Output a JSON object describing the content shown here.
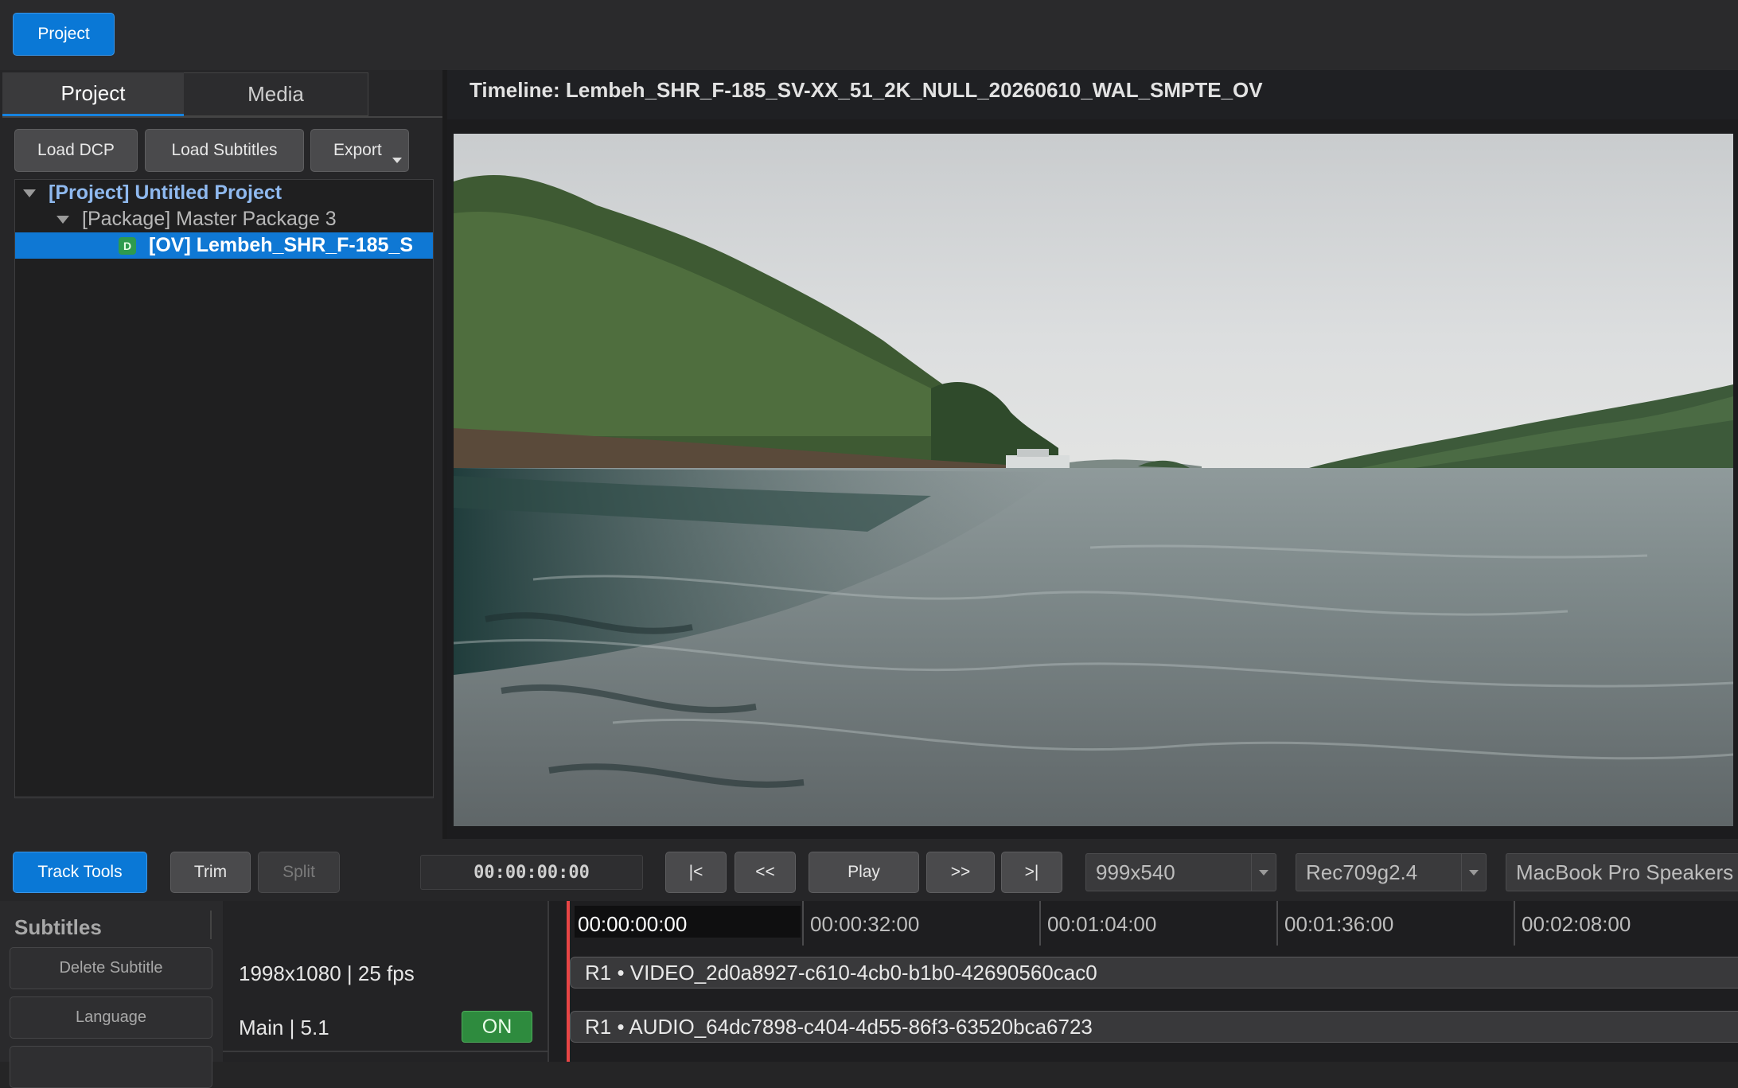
{
  "toolbar": {
    "project_button": "Project"
  },
  "left_panel": {
    "tabs": [
      {
        "label": "Project",
        "active": true
      },
      {
        "label": "Media",
        "active": false
      }
    ],
    "buttons": {
      "load_dcp": "Load DCP",
      "load_subtitles": "Load Subtitles",
      "export": "Export"
    },
    "tree": [
      {
        "label": "[Project] Untitled Project",
        "level": 0
      },
      {
        "label": "[Package] Master Package 3",
        "level": 1
      },
      {
        "label": "[OV] Lembeh_SHR_F-185_S",
        "level": 2,
        "badge": "D",
        "selected": true
      }
    ]
  },
  "viewer": {
    "title": "Timeline: Lembeh_SHR_F-185_SV-XX_51_2K_NULL_20260610_WAL_SMPTE_OV"
  },
  "transport": {
    "track_tools": "Track Tools",
    "trim": "Trim",
    "split": "Split",
    "timecode": "00:00:00:00",
    "go_start": "|<",
    "rewind": "<<",
    "play": "Play",
    "forward": ">>",
    "go_end": ">|",
    "resolution_select": "999x540",
    "colorspace_select": "Rec709g2.4",
    "audio_output_select": "MacBook Pro Speakers"
  },
  "subtitles": {
    "heading": "Subtitles",
    "delete_subtitle": "Delete Subtitle",
    "language": "Language"
  },
  "tracks_info": {
    "video_format": "1998x1080 | 25 fps",
    "audio_format": "Main | 5.1",
    "audio_toggle": "ON"
  },
  "timeline": {
    "ruler": [
      "00:00:00:00",
      "00:00:32:00",
      "00:01:04:00",
      "00:01:36:00",
      "00:02:08:00"
    ],
    "video_track": "R1 • VIDEO_2d0a8927-c610-4cb0-b1b0-42690560cac0",
    "audio_track": "R1 • AUDIO_64dc7898-c404-4d55-86f3-63520bca6723"
  },
  "colors": {
    "accent": "#0a78d6",
    "on_toggle": "#2e8b3e",
    "playhead": "#e84545"
  }
}
